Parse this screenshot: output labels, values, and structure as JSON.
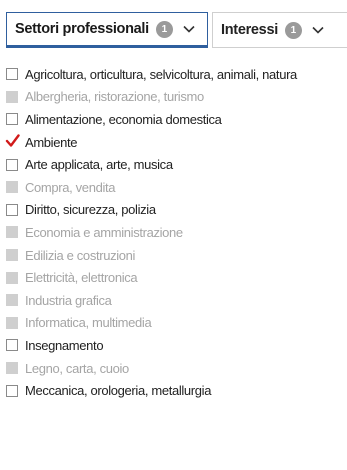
{
  "tabs": {
    "settori": {
      "label": "Settori professionali",
      "badge": "1"
    },
    "interessi": {
      "label": "Interessi",
      "badge": "1"
    }
  },
  "items": [
    {
      "label": "Agricoltura, orticultura, selvicoltura, animali, natura",
      "state": "enabled"
    },
    {
      "label": "Albergheria, ristorazione, turismo",
      "state": "disabled"
    },
    {
      "label": "Alimentazione, economia domestica",
      "state": "enabled"
    },
    {
      "label": "Ambiente",
      "state": "checked"
    },
    {
      "label": "Arte applicata, arte, musica",
      "state": "enabled"
    },
    {
      "label": "Compra, vendita",
      "state": "disabled"
    },
    {
      "label": "Diritto, sicurezza, polizia",
      "state": "enabled"
    },
    {
      "label": "Economia e amministrazione",
      "state": "disabled"
    },
    {
      "label": "Edilizia e costruzioni",
      "state": "disabled"
    },
    {
      "label": "Elettricità, elettronica",
      "state": "disabled"
    },
    {
      "label": "Industria grafica",
      "state": "disabled"
    },
    {
      "label": "Informatica, multimedia",
      "state": "disabled"
    },
    {
      "label": "Insegnamento",
      "state": "enabled"
    },
    {
      "label": "Legno, carta, cuoio",
      "state": "disabled"
    },
    {
      "label": "Meccanica, orologeria, metallurgia",
      "state": "enabled"
    }
  ],
  "colors": {
    "accent": "#2f5f9e",
    "check": "#d11a1a",
    "disabled_text": "#a5a5a5",
    "disabled_box": "#cfcfcf"
  },
  "icons": {
    "tab_chevron": "chevron-down-icon",
    "checked_mark": "checkmark-icon"
  }
}
